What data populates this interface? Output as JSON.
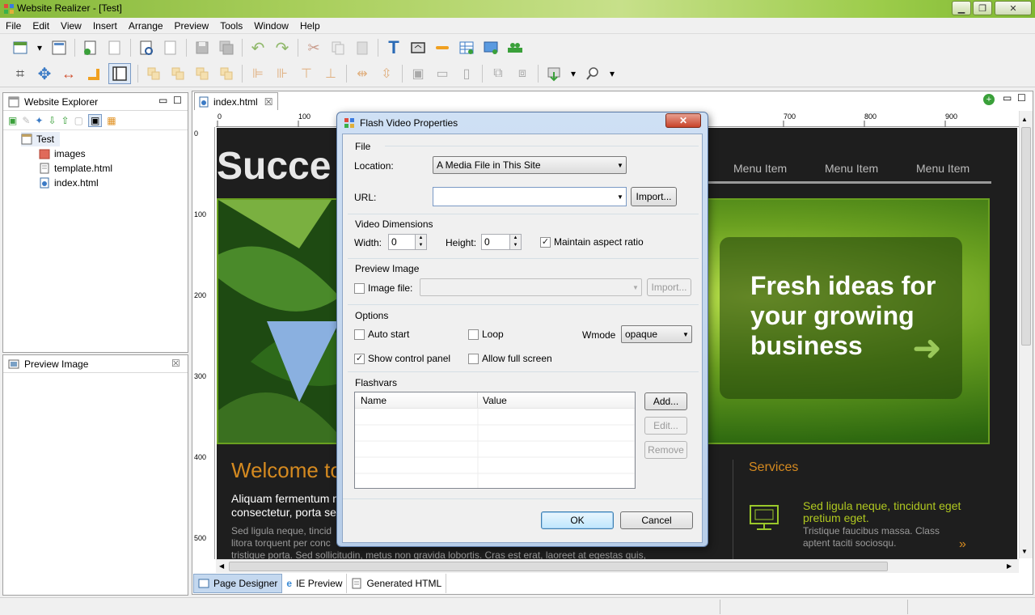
{
  "window": {
    "title": "Website Realizer - [Test]"
  },
  "menu": [
    "File",
    "Edit",
    "View",
    "Insert",
    "Arrange",
    "Preview",
    "Tools",
    "Window",
    "Help"
  ],
  "explorer": {
    "title": "Website Explorer",
    "root": "Test",
    "items": [
      "images",
      "template.html",
      "index.html"
    ]
  },
  "preview_panel": {
    "title": "Preview Image"
  },
  "editor": {
    "tab": "index.html",
    "ruler_h": [
      "0",
      "100",
      "700",
      "800",
      "900"
    ],
    "ruler_v": [
      "0",
      "100",
      "200",
      "300",
      "400",
      "500"
    ]
  },
  "site": {
    "logo_partial": "Succe",
    "menu_items": [
      "Menu Item",
      "Menu Item",
      "Menu Item"
    ],
    "banner": "Fresh ideas for your growing business",
    "welcome": "Welcome to",
    "lead1": "Aliquam fermentum n",
    "lead2": "consectetur, porta se",
    "body1": "Sed ligula neque, tincid",
    "body2": "litora torquent per conc",
    "body3": "tristique porta. Sed sollicitudin, metus non gravida lobortis. Cras est erat, laoreet at egestas quis,",
    "services_title": "Services",
    "service_head": "Sed ligula neque, tincidunt eget pretium eget.",
    "service_text": "Tristique faucibus massa. Class aptent taciti sociosqu."
  },
  "bottom_tabs": [
    "Page Designer",
    "IE Preview",
    "Generated HTML"
  ],
  "dialog": {
    "title": "Flash Video Properties",
    "file_group": "File",
    "location_label": "Location:",
    "location_value": "A Media File in This Site",
    "url_label": "URL:",
    "url_value": "",
    "import_label": "Import...",
    "dims_group": "Video Dimensions",
    "width_label": "Width:",
    "width_value": "0",
    "height_label": "Height:",
    "height_value": "0",
    "aspect_label": "Maintain aspect ratio",
    "aspect_checked": true,
    "preview_group": "Preview Image",
    "image_file_label": "Image file:",
    "image_import_label": "Import...",
    "options_group": "Options",
    "autostart_label": "Auto start",
    "loop_label": "Loop",
    "wmode_label": "Wmode",
    "wmode_value": "opaque",
    "show_control_label": "Show control panel",
    "show_control_checked": true,
    "fullscreen_label": "Allow full screen",
    "flashvars_group": "Flashvars",
    "col_name": "Name",
    "col_value": "Value",
    "add_label": "Add...",
    "edit_label": "Edit...",
    "remove_label": "Remove",
    "ok_label": "OK",
    "cancel_label": "Cancel"
  }
}
